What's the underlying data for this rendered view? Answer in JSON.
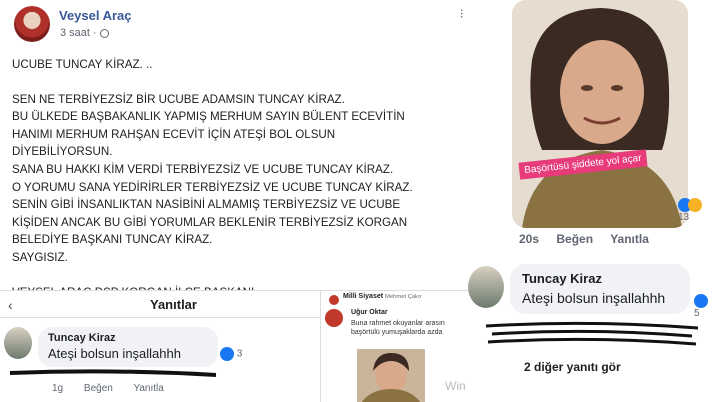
{
  "post": {
    "author": "Veysel Araç",
    "time": "3 saat ·",
    "more": "···",
    "title_line": "UCUBE TUNCAY KİRAZ. ..",
    "paragraph1": "SEN NE TERBİYEZSİZ BİR UCUBE ADAMSIN TUNCAY KİRAZ.\nBU ÜLKEDE BAŞBAKANLIK YAPMIŞ MERHUM SAYIN BÜLENT ECEVİTİN\nHANIMI MERHUM RAHŞAN ECEVİT İÇİN ATEŞİ BOL OLSUN\nDİYEBİLİYORSUN.\nSANA BU HAKKI KİM VERDİ TERBİYEZSİZ VE UCUBE TUNCAY KİRAZ.\nO YORUMU SANA YEDİRİRLER TERBİYEZSİZ VE UCUBE TUNCAY KİRAZ.\nSENİN GİBİ İNSANLIKTAN NASİBİNİ ALMAMIŞ TERBİYEZSİZ VE UCUBE\nKİŞİDEN ANCAK BU GİBİ YORUMLAR BEKLENİR TERBİYEZSİZ KORGAN\nBELEDİYE BAŞKANI TUNCAY KİRAZ.\nSAYGISIZ.",
    "signature": "VEYSEL ARAÇ DSP KORGAN İLÇE BAŞKANI"
  },
  "right_panel": {
    "photo_caption": "Başörtüsü şiddete yol açar",
    "reaction_count": "13",
    "time": "20s",
    "like_action": "Beğen",
    "reply_action": "Yanıtla",
    "comment_author": "Tuncay Kiraz",
    "comment_text": "Ateşi bolsun inşallahhh",
    "comment_like_count": "5",
    "more_replies": "2 diğer yanıtı gör"
  },
  "replies_panel": {
    "back_label": "‹",
    "heading": "Yanıtlar",
    "comment_author": "Tuncay Kiraz",
    "comment_text": "Ateşi bolsun inşallahhh",
    "comment_like_count": "3",
    "time": "1g",
    "like_action": "Beğen",
    "reply_action": "Yanıtla"
  },
  "news_panel": {
    "source": "Milli Siyaset",
    "source_author": "Mehmet Çakır ",
    "user": "Uğur Oktar",
    "snippet": "Buna rahmet okuyanlar arasın\nbaşörtülü yumuşaklarda azda",
    "watermark": "Win"
  },
  "colors": {
    "author_link": "#385898",
    "bubble_bg": "#f0f2f5",
    "like_blue": "#1877f2",
    "caption_pink": "#e73b7a"
  }
}
